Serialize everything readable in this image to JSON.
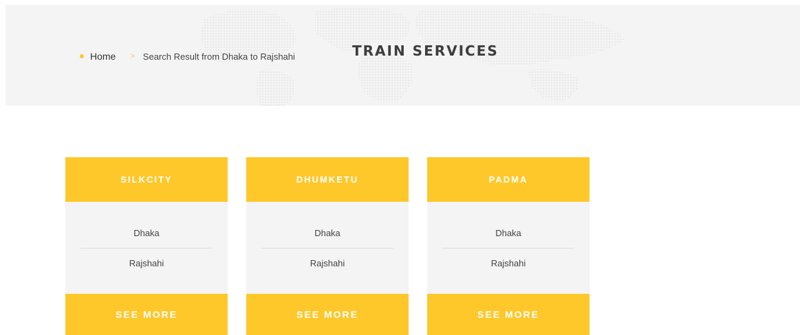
{
  "header": {
    "title": "TRAIN SERVICES",
    "breadcrumb": {
      "home": "Home",
      "separator": ">",
      "current": "Search Result from Dhaka to Rajshahi"
    }
  },
  "colors": {
    "accent": "#fec82b",
    "card_background": "#f4f4f4",
    "header_background": "#f4f4f4"
  },
  "trains": [
    {
      "name": "SILKCITY",
      "from": "Dhaka",
      "to": "Rajshahi",
      "action": "SEE MORE"
    },
    {
      "name": "DHUMKETU",
      "from": "Dhaka",
      "to": "Rajshahi",
      "action": "SEE MORE"
    },
    {
      "name": "PADMA",
      "from": "Dhaka",
      "to": "Rajshahi",
      "action": "SEE MORE"
    }
  ]
}
